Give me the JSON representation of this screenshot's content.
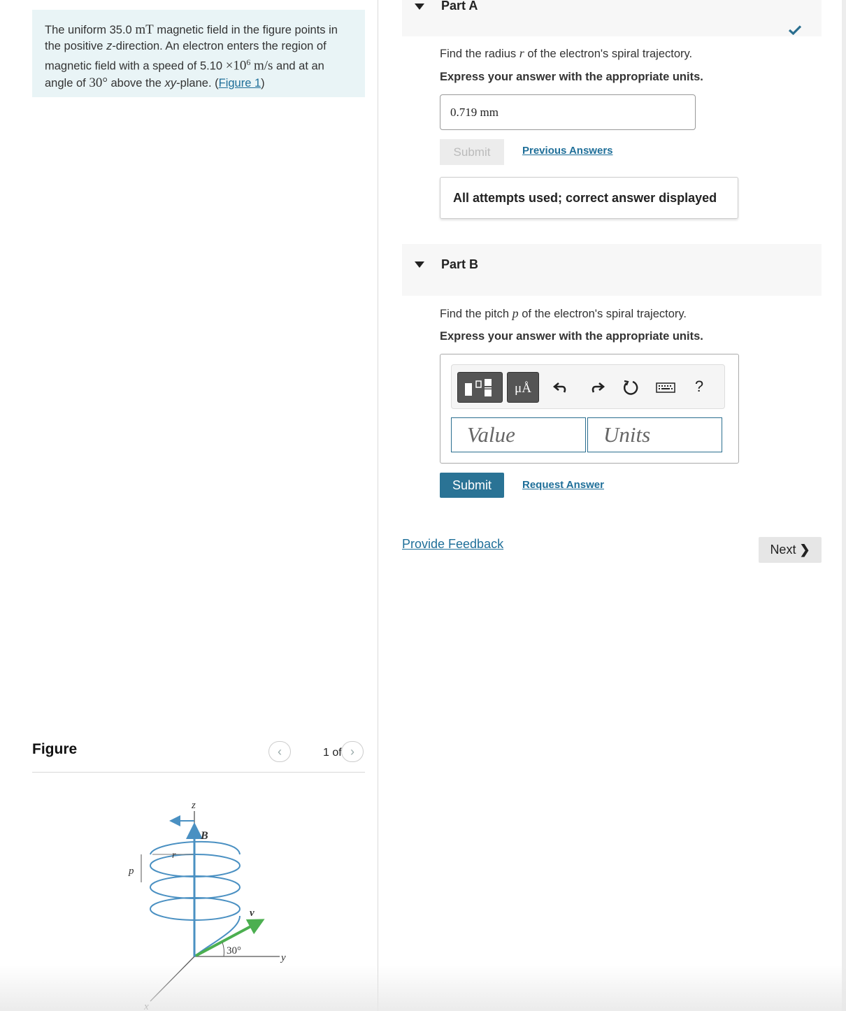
{
  "problem": {
    "text_1": "The uniform ",
    "field_value": "35.0",
    "field_unit": "mT",
    "text_2": " magnetic field in the figure points in the positive ",
    "z_axis": "z",
    "text_3": "-direction. An electron enters the region of magnetic field with a speed of ",
    "speed_mantissa": "5.10",
    "speed_times": "×10",
    "speed_exponent": "6",
    "speed_unit": "m/s",
    "text_4": " and at an angle of ",
    "angle": "30°",
    "text_5": " above the ",
    "plane": "xy",
    "text_6": "-plane. (",
    "figure_link": "Figure 1",
    "text_7": ")"
  },
  "figure_panel": {
    "title": "Figure",
    "prev_icon": "chevron-left-icon",
    "next_icon": "chevron-right-icon",
    "counter": "1 of 1",
    "labels": {
      "z": "z",
      "x": "x",
      "y": "y",
      "B": "B",
      "v": "v",
      "r": "r",
      "p": "p",
      "angle": "30°"
    }
  },
  "part_a": {
    "label": "Part A",
    "status_icon": "checkmark-icon",
    "question_pre": "Find the radius ",
    "question_var": "r",
    "question_post": " of the electron's spiral trajectory.",
    "instruction": "Express your answer with the appropriate units.",
    "answer": "0.719 mm",
    "submit_label": "Submit",
    "previous_answers_label": "Previous Answers",
    "status_message": "All attempts used; correct answer displayed"
  },
  "part_b": {
    "label": "Part B",
    "question_pre": "Find the pitch ",
    "question_var": "p",
    "question_post": " of the electron's spiral trajectory.",
    "instruction": "Express your answer with the appropriate units.",
    "toolbar": {
      "templates_icon": "templates-icon",
      "units_icon_label": "μÅ",
      "undo_icon": "undo-icon",
      "redo_icon": "redo-icon",
      "reset_icon": "reset-icon",
      "keyboard_icon": "keyboard-icon",
      "help_label": "?"
    },
    "value_placeholder": "Value",
    "units_placeholder": "Units",
    "submit_label": "Submit",
    "request_answer_label": "Request Answer"
  },
  "footer": {
    "feedback_label": "Provide Feedback",
    "next_label": "Next",
    "next_icon": "chevron-right-icon"
  },
  "colors": {
    "problem_bg": "#e9f4f6",
    "link": "#1f6f99",
    "submit": "#2a7395",
    "check": "#2a6e8f",
    "helix": "#4a90c2",
    "velocity": "#4caf50"
  }
}
